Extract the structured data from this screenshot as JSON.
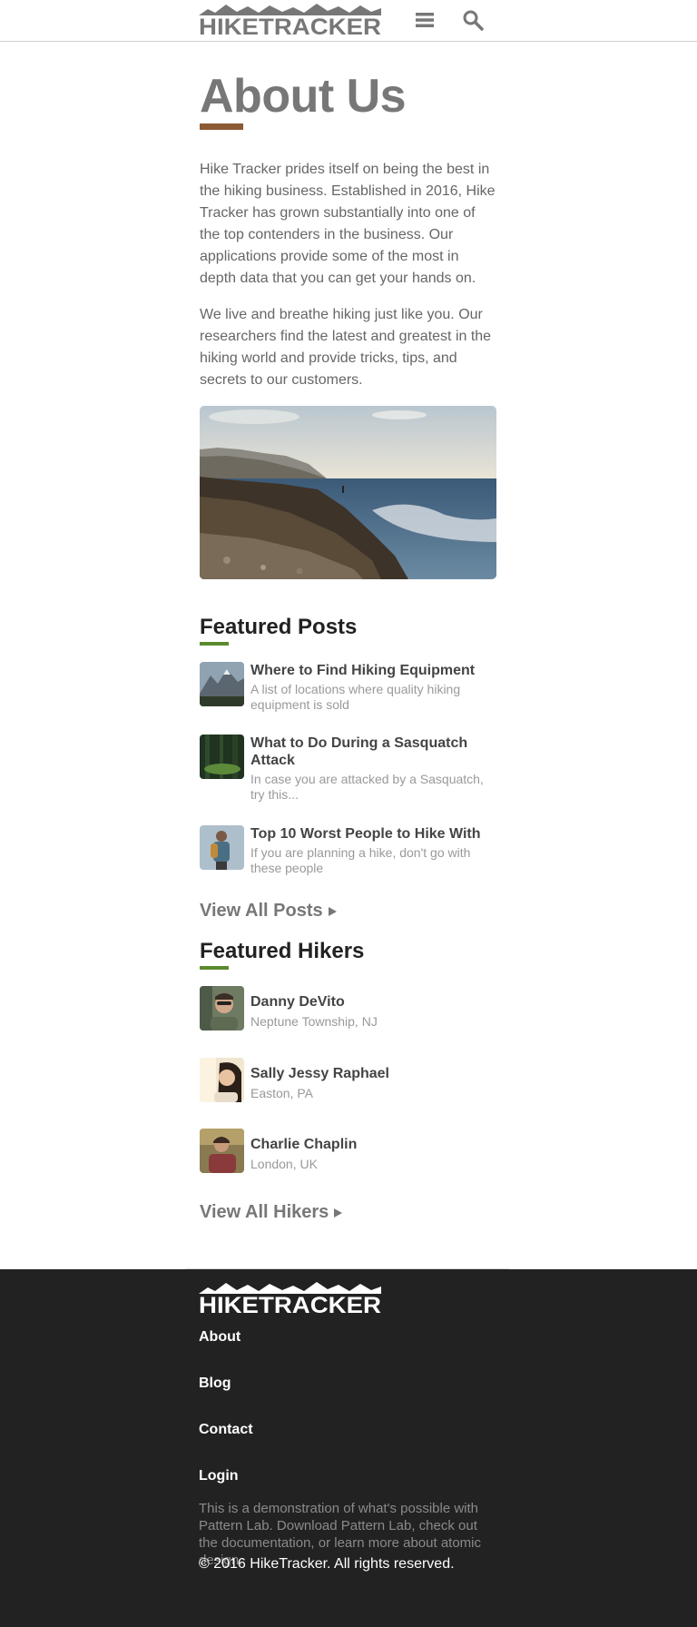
{
  "header": {
    "logo_text": "HIKETRACKER",
    "menu_icon": "menu-icon",
    "search_icon": "search-icon"
  },
  "about": {
    "title": "About Us",
    "paragraph1": "Hike Tracker prides itself on being the best in the hiking business. Established in 2016, Hike Tracker has grown substantially into one of the top contenders in the business. Our applications provide some of the most in depth data that you can get your hands on.",
    "paragraph2": "We live and breathe hiking just like you. Our researchers find the latest and greatest in the hiking world and provide tricks, tips, and secrets to our customers."
  },
  "featured_posts": {
    "title": "Featured Posts",
    "posts": [
      {
        "title": "Where to Find Hiking Equipment",
        "excerpt": "A list of locations where quality hiking equipment is sold"
      },
      {
        "title": "What to Do During a Sasquatch Attack",
        "excerpt": "In case you are attacked by a Sasquatch, try this..."
      },
      {
        "title": "Top 10 Worst People to Hike With",
        "excerpt": "If you are planning a hike, don't go with these people"
      }
    ],
    "view_all": "View All Posts"
  },
  "featured_hikers": {
    "title": "Featured Hikers",
    "hikers": [
      {
        "name": "Danny DeVito",
        "location": "Neptune Township, NJ"
      },
      {
        "name": "Sally Jessy Raphael",
        "location": "Easton, PA"
      },
      {
        "name": "Charlie Chaplin",
        "location": "London, UK"
      }
    ],
    "view_all": "View All Hikers"
  },
  "footer": {
    "logo_text": "HIKETRACKER",
    "links": [
      "About",
      "Blog",
      "Contact",
      "Login"
    ],
    "description": "This is a demonstration of what's possible with Pattern Lab. Download Pattern Lab, check out the documentation, or learn more about atomic design.",
    "copyright": "© 2016 HikeTracker. All rights reserved."
  },
  "colors": {
    "title_accent": "#8c5a34",
    "section_accent": "#5a8a2e",
    "footer_bg": "#222222"
  }
}
